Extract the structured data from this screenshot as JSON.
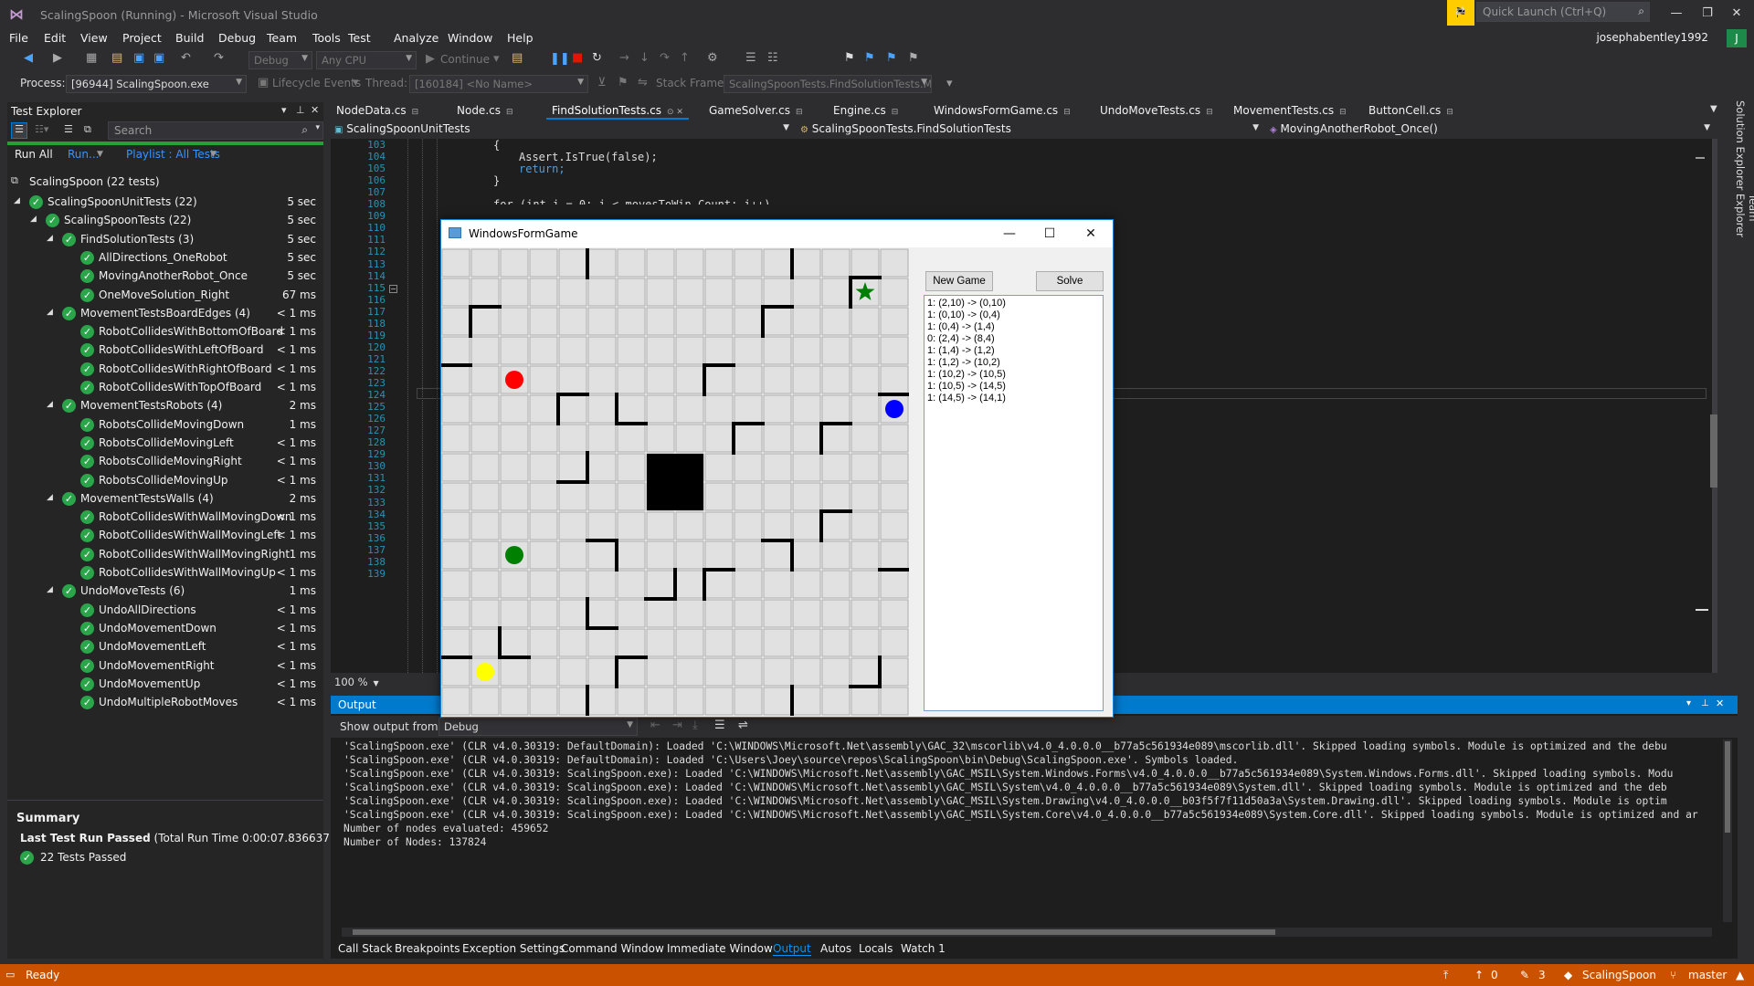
{
  "app": {
    "title": "ScalingSpoon (Running) - Microsoft Visual Studio",
    "quick_launch_placeholder": "Quick Launch (Ctrl+Q)",
    "user": "josephabentley1992",
    "user_initial": "J"
  },
  "menu": [
    "File",
    "Edit",
    "View",
    "Project",
    "Build",
    "Debug",
    "Team",
    "Tools",
    "Test",
    "Analyze",
    "Window",
    "Help"
  ],
  "toolbar": {
    "config": "Debug",
    "platform": "Any CPU",
    "continue_label": "Continue",
    "process_label": "Process:",
    "process_value": "[96944] ScalingSpoon.exe",
    "lifecycle_label": "Lifecycle Events",
    "thread_label": "Thread:",
    "thread_value": "[160184] <No Name>",
    "stack_frame_label": "Stack Frame:",
    "stack_frame_value": "ScalingSpoonTests.FindSolutionTests.Mov"
  },
  "test_explorer": {
    "title": "Test Explorer",
    "search_placeholder": "Search",
    "run_all": "Run All",
    "run": "Run...",
    "playlist": "Playlist : All Tests",
    "root": "ScalingSpoon (22 tests)",
    "tree": [
      {
        "level": 0,
        "name": "ScalingSpoonUnitTests (22)",
        "time": "5 sec",
        "expand": true
      },
      {
        "level": 1,
        "name": "ScalingSpoonTests (22)",
        "time": "5 sec",
        "expand": true
      },
      {
        "level": 2,
        "name": "FindSolutionTests (3)",
        "time": "5 sec",
        "expand": true
      },
      {
        "level": 3,
        "name": "AllDirections_OneRobot",
        "time": "5 sec"
      },
      {
        "level": 3,
        "name": "MovingAnotherRobot_Once",
        "time": "5 sec"
      },
      {
        "level": 3,
        "name": "OneMoveSolution_Right",
        "time": "67 ms"
      },
      {
        "level": 2,
        "name": "MovementTestsBoardEdges (4)",
        "time": "< 1 ms",
        "expand": true
      },
      {
        "level": 3,
        "name": "RobotCollidesWithBottomOfBoard",
        "time": "< 1 ms"
      },
      {
        "level": 3,
        "name": "RobotCollidesWithLeftOfBoard",
        "time": "< 1 ms"
      },
      {
        "level": 3,
        "name": "RobotCollidesWithRightOfBoard",
        "time": "< 1 ms"
      },
      {
        "level": 3,
        "name": "RobotCollidesWithTopOfBoard",
        "time": "< 1 ms"
      },
      {
        "level": 2,
        "name": "MovementTestsRobots (4)",
        "time": "2 ms",
        "expand": true
      },
      {
        "level": 3,
        "name": "RobotsCollideMovingDown",
        "time": "1 ms"
      },
      {
        "level": 3,
        "name": "RobotsCollideMovingLeft",
        "time": "< 1 ms"
      },
      {
        "level": 3,
        "name": "RobotsCollideMovingRight",
        "time": "< 1 ms"
      },
      {
        "level": 3,
        "name": "RobotsCollideMovingUp",
        "time": "< 1 ms"
      },
      {
        "level": 2,
        "name": "MovementTestsWalls (4)",
        "time": "2 ms",
        "expand": true
      },
      {
        "level": 3,
        "name": "RobotCollidesWithWallMovingDown",
        "time": "< 1 ms"
      },
      {
        "level": 3,
        "name": "RobotCollidesWithWallMovingLeft",
        "time": "< 1 ms"
      },
      {
        "level": 3,
        "name": "RobotCollidesWithWallMovingRight",
        "time": "1 ms"
      },
      {
        "level": 3,
        "name": "RobotCollidesWithWallMovingUp",
        "time": "< 1 ms"
      },
      {
        "level": 2,
        "name": "UndoMoveTests (6)",
        "time": "1 ms",
        "expand": true
      },
      {
        "level": 3,
        "name": "UndoAllDirections",
        "time": "< 1 ms"
      },
      {
        "level": 3,
        "name": "UndoMovementDown",
        "time": "< 1 ms"
      },
      {
        "level": 3,
        "name": "UndoMovementLeft",
        "time": "< 1 ms"
      },
      {
        "level": 3,
        "name": "UndoMovementRight",
        "time": "< 1 ms"
      },
      {
        "level": 3,
        "name": "UndoMovementUp",
        "time": "< 1 ms"
      },
      {
        "level": 3,
        "name": "UndoMultipleRobotMoves",
        "time": "< 1 ms"
      }
    ],
    "summary_title": "Summary",
    "summary_last": "Last Test Run Passed",
    "summary_total": "(Total Run Time 0:00:07.836637)",
    "summary_passed": "22 Tests Passed"
  },
  "tabs": [
    "NodeData.cs",
    "Node.cs",
    "FindSolutionTests.cs",
    "GameSolver.cs",
    "Engine.cs",
    "WindowsFormGame.cs",
    "UndoMoveTests.cs",
    "MovementTests.cs",
    "ButtonCell.cs"
  ],
  "active_tab": "FindSolutionTests.cs",
  "nav": {
    "project": "ScalingSpoonUnitTests",
    "class": "ScalingSpoonTests.FindSolutionTests",
    "member": "MovingAnotherRobot_Once()"
  },
  "code": {
    "line_numbers": [
      "103",
      "104",
      "105",
      "106",
      "107",
      "108",
      "109",
      "110",
      "111",
      "112",
      "113",
      "114",
      "115",
      "116",
      "117",
      "118",
      "119",
      "120",
      "121",
      "122",
      "123",
      "124",
      "125",
      "126",
      "127",
      "128",
      "129",
      "130",
      "131",
      "132",
      "133",
      "134",
      "135",
      "136",
      "137",
      "138",
      "139"
    ],
    "lines": [
      {
        "n": "103",
        "text": "{"
      },
      {
        "n": "104",
        "text": "Assert.IsTrue(false);"
      },
      {
        "n": "105",
        "text": "return;"
      },
      {
        "n": "106",
        "text": "}"
      },
      {
        "n": "108",
        "text": "for (int i = 0; i < movesToWin.Count; i++)"
      }
    ],
    "zoom": "100 %"
  },
  "form": {
    "title": "WindowsFormGame",
    "new_game": "New Game",
    "solve": "Solve",
    "moves": [
      "1: (2,10) -> (0,10)",
      "1: (0,10) -> (0,4)",
      "1: (0,4) -> (1,4)",
      "0: (2,4) -> (8,4)",
      "1: (1,4) -> (1,2)",
      "1: (1,2) -> (10,2)",
      "1: (10,2) -> (10,5)",
      "1: (10,5) -> (14,5)",
      "1: (14,5) -> (14,1)"
    ],
    "board": {
      "size": 16,
      "robots": [
        {
          "color": "#ff0000",
          "col": 2,
          "row": 4
        },
        {
          "color": "#0000ff",
          "col": 15,
          "row": 5
        },
        {
          "color": "#008000",
          "col": 2,
          "row": 10
        },
        {
          "color": "#ffff00",
          "col": 1,
          "row": 14
        }
      ],
      "target": {
        "color": "#008000",
        "col": 14,
        "row": 1
      },
      "center_block": {
        "col": 7,
        "row": 7,
        "w": 2,
        "h": 2
      },
      "walls": [
        {
          "col": 4,
          "row": 0,
          "side": "r"
        },
        {
          "col": 11,
          "row": 0,
          "side": "r"
        },
        {
          "col": 14,
          "row": 1,
          "side": "t"
        },
        {
          "col": 14,
          "row": 1,
          "side": "l"
        },
        {
          "col": 1,
          "row": 2,
          "side": "t"
        },
        {
          "col": 1,
          "row": 2,
          "side": "l"
        },
        {
          "col": 11,
          "row": 2,
          "side": "t"
        },
        {
          "col": 11,
          "row": 2,
          "side": "l"
        },
        {
          "col": 0,
          "row": 4,
          "side": "t"
        },
        {
          "col": 9,
          "row": 4,
          "side": "t"
        },
        {
          "col": 9,
          "row": 4,
          "side": "l"
        },
        {
          "col": 4,
          "row": 5,
          "side": "t"
        },
        {
          "col": 4,
          "row": 5,
          "side": "l"
        },
        {
          "col": 6,
          "row": 5,
          "side": "l"
        },
        {
          "col": 6,
          "row": 5,
          "side": "b"
        },
        {
          "col": 15,
          "row": 5,
          "side": "t"
        },
        {
          "col": 10,
          "row": 6,
          "side": "t"
        },
        {
          "col": 10,
          "row": 6,
          "side": "l"
        },
        {
          "col": 13,
          "row": 6,
          "side": "t"
        },
        {
          "col": 13,
          "row": 6,
          "side": "l"
        },
        {
          "col": 4,
          "row": 7,
          "side": "r"
        },
        {
          "col": 4,
          "row": 7,
          "side": "b"
        },
        {
          "col": 13,
          "row": 9,
          "side": "t"
        },
        {
          "col": 13,
          "row": 9,
          "side": "l"
        },
        {
          "col": 5,
          "row": 10,
          "side": "t"
        },
        {
          "col": 5,
          "row": 10,
          "side": "r"
        },
        {
          "col": 11,
          "row": 10,
          "side": "t"
        },
        {
          "col": 11,
          "row": 10,
          "side": "r"
        },
        {
          "col": 15,
          "row": 11,
          "side": "t"
        },
        {
          "col": 7,
          "row": 11,
          "side": "r"
        },
        {
          "col": 7,
          "row": 11,
          "side": "b"
        },
        {
          "col": 9,
          "row": 11,
          "side": "t"
        },
        {
          "col": 9,
          "row": 11,
          "side": "l"
        },
        {
          "col": 5,
          "row": 12,
          "side": "l"
        },
        {
          "col": 5,
          "row": 12,
          "side": "b"
        },
        {
          "col": 0,
          "row": 13,
          "side": "b"
        },
        {
          "col": 2,
          "row": 13,
          "side": "l"
        },
        {
          "col": 2,
          "row": 13,
          "side": "b"
        },
        {
          "col": 6,
          "row": 14,
          "side": "t"
        },
        {
          "col": 6,
          "row": 14,
          "side": "l"
        },
        {
          "col": 14,
          "row": 14,
          "side": "r"
        },
        {
          "col": 14,
          "row": 14,
          "side": "b"
        },
        {
          "col": 4,
          "row": 15,
          "side": "r"
        },
        {
          "col": 11,
          "row": 15,
          "side": "r"
        }
      ]
    }
  },
  "output": {
    "title": "Output",
    "show_from_label": "Show output from:",
    "show_from_value": "Debug",
    "lines": [
      "'ScalingSpoon.exe' (CLR v4.0.30319: DefaultDomain): Loaded 'C:\\WINDOWS\\Microsoft.Net\\assembly\\GAC_32\\mscorlib\\v4.0_4.0.0.0__b77a5c561934e089\\mscorlib.dll'. Skipped loading symbols. Module is optimized and the debu",
      "'ScalingSpoon.exe' (CLR v4.0.30319: DefaultDomain): Loaded 'C:\\Users\\Joey\\source\\repos\\ScalingSpoon\\bin\\Debug\\ScalingSpoon.exe'. Symbols loaded.",
      "'ScalingSpoon.exe' (CLR v4.0.30319: ScalingSpoon.exe): Loaded 'C:\\WINDOWS\\Microsoft.Net\\assembly\\GAC_MSIL\\System.Windows.Forms\\v4.0_4.0.0.0__b77a5c561934e089\\System.Windows.Forms.dll'. Skipped loading symbols. Modu",
      "'ScalingSpoon.exe' (CLR v4.0.30319: ScalingSpoon.exe): Loaded 'C:\\WINDOWS\\Microsoft.Net\\assembly\\GAC_MSIL\\System\\v4.0_4.0.0.0__b77a5c561934e089\\System.dll'. Skipped loading symbols. Module is optimized and the deb",
      "'ScalingSpoon.exe' (CLR v4.0.30319: ScalingSpoon.exe): Loaded 'C:\\WINDOWS\\Microsoft.Net\\assembly\\GAC_MSIL\\System.Drawing\\v4.0_4.0.0.0__b03f5f7f11d50a3a\\System.Drawing.dll'. Skipped loading symbols. Module is optim",
      "'ScalingSpoon.exe' (CLR v4.0.30319: ScalingSpoon.exe): Loaded 'C:\\WINDOWS\\Microsoft.Net\\assembly\\GAC_MSIL\\System.Core\\v4.0_4.0.0.0__b77a5c561934e089\\System.Core.dll'. Skipped loading symbols. Module is optimized and ar",
      "Number of nodes evaluated: 459652",
      "Number of Nodes: 137824"
    ]
  },
  "bottom_tabs": [
    "Call Stack",
    "Breakpoints",
    "Exception Settings",
    "Command Window",
    "Immediate Window",
    "Output",
    "Autos",
    "Locals",
    "Watch 1"
  ],
  "bottom_active": "Output",
  "side_rail": [
    "Solution Explorer",
    "Team Explorer"
  ],
  "status": {
    "ready": "Ready",
    "up": "0",
    "pencil": "3",
    "repo": "ScalingSpoon",
    "branch": "master"
  },
  "colors": {
    "accent": "#007acc",
    "status": "#ca5100",
    "pass": "#2aa54a"
  }
}
